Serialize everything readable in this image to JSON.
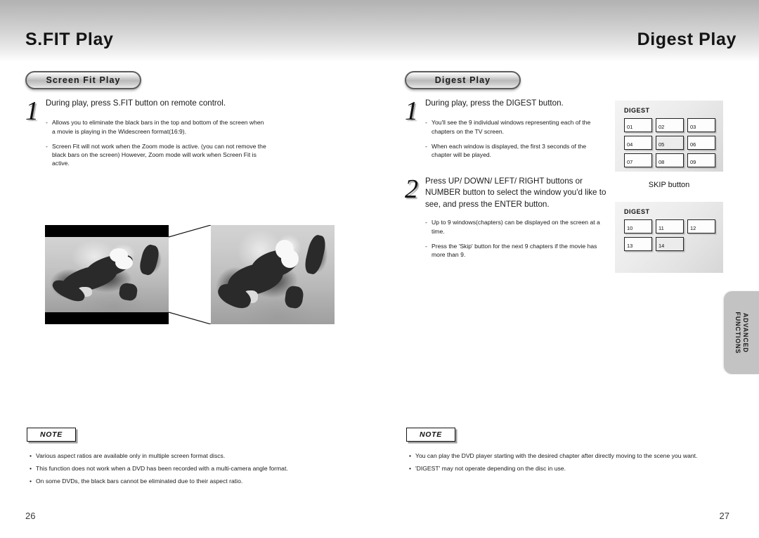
{
  "left_page": {
    "title": "S.FIT Play",
    "pill_label": "Screen Fit Play",
    "page_number": "26",
    "steps": [
      {
        "number": "1",
        "text": "During play, press S.FIT button on remote control.",
        "sub_items": [
          "Allows you to eliminate the black bars in the top and bottom of the screen when a movie is playing in the Widescreen format(16:9).",
          "Screen Fit will not work when the Zoom mode is active. (you can not remove the black bars on the screen) However, Zoom mode will work when Screen Fit is active."
        ]
      }
    ],
    "note": {
      "label": "NOTE",
      "items": [
        "Various aspect ratios are available only in multiple screen format discs.",
        "This function does not work when a DVD has been recorded with a multi-camera angle format.",
        "On some DVDs, the black bars cannot be eliminated due to their aspect ratio."
      ]
    },
    "figure": {
      "caption_left": "letterboxed-screen",
      "caption_right": "screen-fit-screen"
    }
  },
  "right_page": {
    "title": "Digest Play",
    "pill_label": "Digest Play",
    "page_number": "27",
    "steps": [
      {
        "number": "1",
        "text": "During play, press the DIGEST button.",
        "sub_items": [
          "You'll see the 9 individual windows representing each of the chapters on the TV screen.",
          "When each window is displayed, the first 3 seconds of the chapter will be played."
        ]
      },
      {
        "number": "2",
        "text": "Press UP/ DOWN/ LEFT/ RIGHT buttons or NUMBER button to select the window you'd like to see, and press the ENTER button.",
        "sub_items": [
          "Up to 9 windows(chapters) can be displayed on the screen at a time.",
          "Press the 'Skip' button for the next 9 chapters if the movie has more than 9."
        ]
      }
    ],
    "digest_panels": [
      {
        "label": "DIGEST",
        "cells": [
          "01",
          "02",
          "03",
          "04",
          "05",
          "06",
          "07",
          "08",
          "09"
        ]
      },
      {
        "label": "DIGEST",
        "cells": [
          "10",
          "11",
          "12",
          "13",
          "14"
        ]
      }
    ],
    "skip_label": "SKIP button",
    "note": {
      "label": "NOTE",
      "items": [
        "You can play the DVD player starting with the desired chapter after directly moving to the scene you want.",
        "'DIGEST' may not operate depending on the disc in use."
      ]
    }
  },
  "side_tab": {
    "line1": "ADVANCED",
    "line2": "FUNCTIONS"
  }
}
